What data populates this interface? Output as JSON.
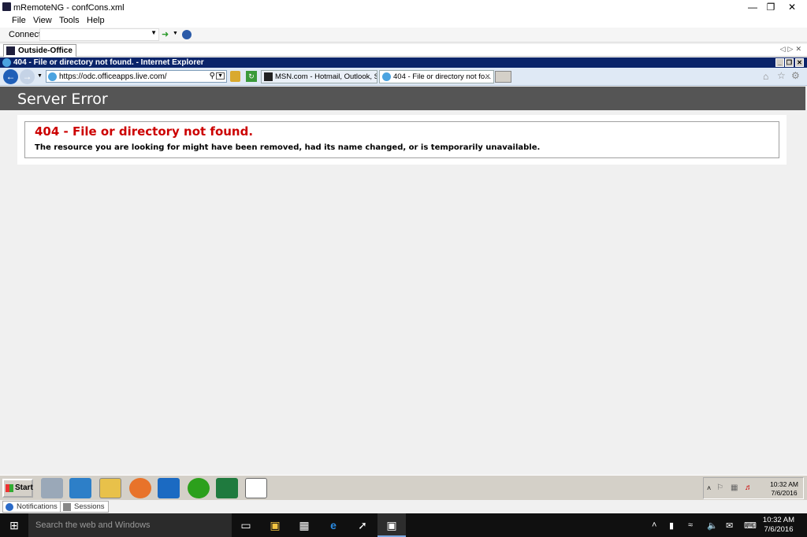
{
  "app": {
    "window_title": "mRemoteNG - confCons.xml",
    "menu": [
      "File",
      "View",
      "Tools",
      "Help"
    ],
    "connect_label": "Connect:",
    "connect_value": "",
    "document_tab": "Outside-Office"
  },
  "ie": {
    "window_title": "404 - File or directory not found. - Internet Explorer",
    "address": "https://odc.officeapps.live.com/",
    "tabs": [
      "MSN.com - Hotmail, Outlook, Sk...",
      "404 - File or directory not fo..."
    ]
  },
  "page": {
    "header": "Server Error",
    "error_title": "404 - File or directory not found.",
    "error_message": "The resource you are looking for might have been removed, had its name changed, or is temporarily unavailable."
  },
  "remote_taskbar": {
    "start_label": "Start",
    "clock_time": "10:32 AM",
    "clock_date": "7/6/2016"
  },
  "status_tabs": [
    "Notifications",
    "Sessions"
  ],
  "win_taskbar": {
    "search_placeholder": "Search the web and Windows",
    "clock_time": "10:32 AM",
    "clock_date": "7/6/2016"
  },
  "colors": {
    "header_bg": "#555555",
    "error_red": "#cc0000",
    "ie_title_bg": "#0a246a"
  }
}
